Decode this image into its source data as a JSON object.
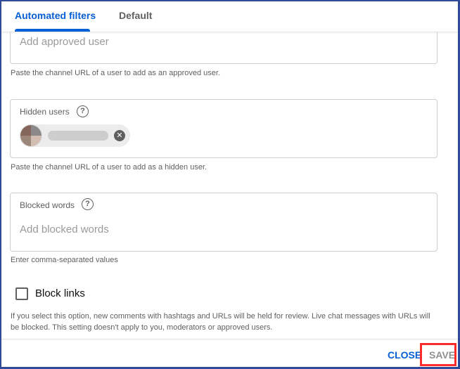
{
  "tabs": [
    {
      "label": "Automated filters",
      "active": true
    },
    {
      "label": "Default",
      "active": false
    }
  ],
  "approved_users": {
    "placeholder": "Add approved user",
    "helper": "Paste the channel URL of a user to add as an approved user."
  },
  "hidden_users": {
    "label": "Hidden users",
    "help_icon": "help-circle-icon",
    "help_glyph": "?",
    "chips": [
      {
        "name": "[blurred username]",
        "remove_glyph": "✕"
      }
    ],
    "helper": "Paste the channel URL of a user to add as a hidden user."
  },
  "blocked_words": {
    "label": "Blocked words",
    "help_icon": "help-circle-icon",
    "help_glyph": "?",
    "placeholder": "Add blocked words",
    "helper": "Enter comma-separated values"
  },
  "block_links": {
    "label": "Block links",
    "checked": false,
    "description": "If you select this option, new comments with hashtags and URLs will be held for review. Live chat messages with URLs will be blocked. This setting doesn't apply to you, moderators or approved users."
  },
  "footer": {
    "close_label": "CLOSE",
    "save_label": "SAVE",
    "save_enabled": false
  },
  "colors": {
    "accent": "#065fd4",
    "highlight": "#ff2a2a",
    "frame": "#2f4a9a"
  }
}
